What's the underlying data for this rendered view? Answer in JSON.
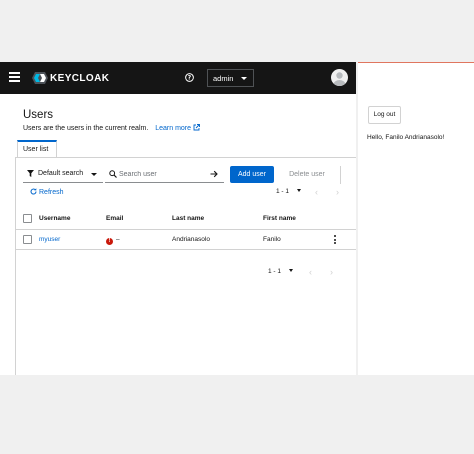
{
  "masthead": {
    "brand": "KEYCLOAK",
    "realm_selector": "admin"
  },
  "page": {
    "title": "Users",
    "description": "Users are the users in the current realm.",
    "learn_more": "Learn more"
  },
  "tabs": [
    {
      "label": "User list"
    }
  ],
  "toolbar": {
    "filter_label": "Default search",
    "search_placeholder": "Search user",
    "add_user": "Add user",
    "delete_user": "Delete user",
    "refresh": "Refresh",
    "pagination": "1 - 1"
  },
  "table": {
    "columns": [
      "Username",
      "Email",
      "Last name",
      "First name"
    ],
    "rows": [
      {
        "username": "myuser",
        "email": "–",
        "last_name": "Andrianasolo",
        "first_name": "Fanilo"
      }
    ]
  },
  "footer": {
    "pagination": "1 - 1"
  },
  "side_panel": {
    "logout": "Log out",
    "greeting": "Hello, Fanilo Andrianasolo!"
  },
  "colors": {
    "masthead": "#151515",
    "primary": "#0066cc",
    "error": "#c9190b",
    "panel_accent": "#e0765f"
  }
}
